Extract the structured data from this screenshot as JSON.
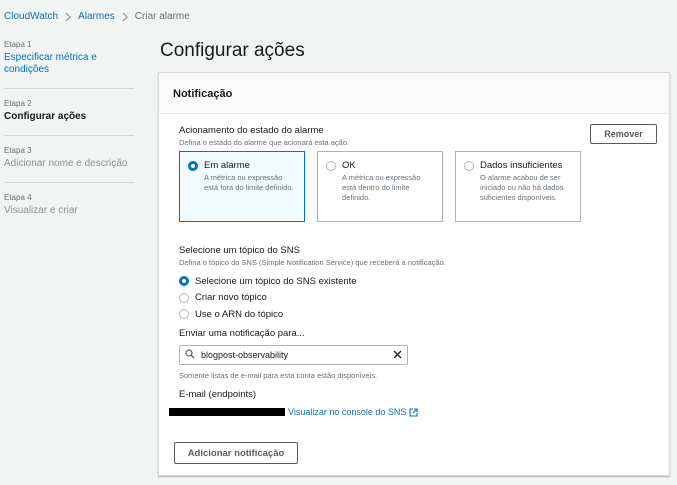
{
  "breadcrumb": {
    "items": [
      "CloudWatch",
      "Alarmes",
      "Criar alarme"
    ]
  },
  "steps": [
    {
      "num": "Etapa 1",
      "label": "Especificar métrica e condições"
    },
    {
      "num": "Etapa 2",
      "label": "Configurar ações"
    },
    {
      "num": "Etapa 3",
      "label": "Adicionar nome e descrição"
    },
    {
      "num": "Etapa 4",
      "label": "Visualizar e criar"
    }
  ],
  "page_title": "Configurar ações",
  "panel": {
    "title": "Notificação",
    "remove_label": "Remover",
    "trigger": {
      "label": "Acionamento do estado do alarme",
      "desc": "Defina o estado do alarme que acionará esta ação.",
      "options": [
        {
          "title": "Em alarme",
          "desc": "A métrica ou expressão está fora do limite definido.",
          "selected": true
        },
        {
          "title": "OK",
          "desc": "A métrica ou expressão está dentro do limite definido.",
          "selected": false
        },
        {
          "title": "Dados insuficientes",
          "desc": "O alarme acabou de ser iniciado ou não há dados suficientes disponíveis.",
          "selected": false
        }
      ]
    },
    "sns": {
      "label": "Selecione um tópico do SNS",
      "desc": "Defina o tópico do SNS (Simple Notification Service) que receberá a notificação.",
      "options": [
        {
          "label": "Selecione um tópico do SNS existente",
          "checked": true
        },
        {
          "label": "Criar novo tópico",
          "checked": false
        },
        {
          "label": "Use o ARN do tópico",
          "checked": false
        }
      ]
    },
    "send": {
      "label": "Enviar uma notificação para...",
      "value": "blogpost-observability",
      "hint": "Somente listas de e-mail para esta conta estão disponíveis."
    },
    "email": {
      "label": "E-mail (endpoints)",
      "link": "Visualizar no console do SNS"
    },
    "add_label": "Adicionar notificação"
  },
  "colors": {
    "link": "#0073bb",
    "selected_bg": "#f1faff",
    "border": "#aab7b8"
  }
}
